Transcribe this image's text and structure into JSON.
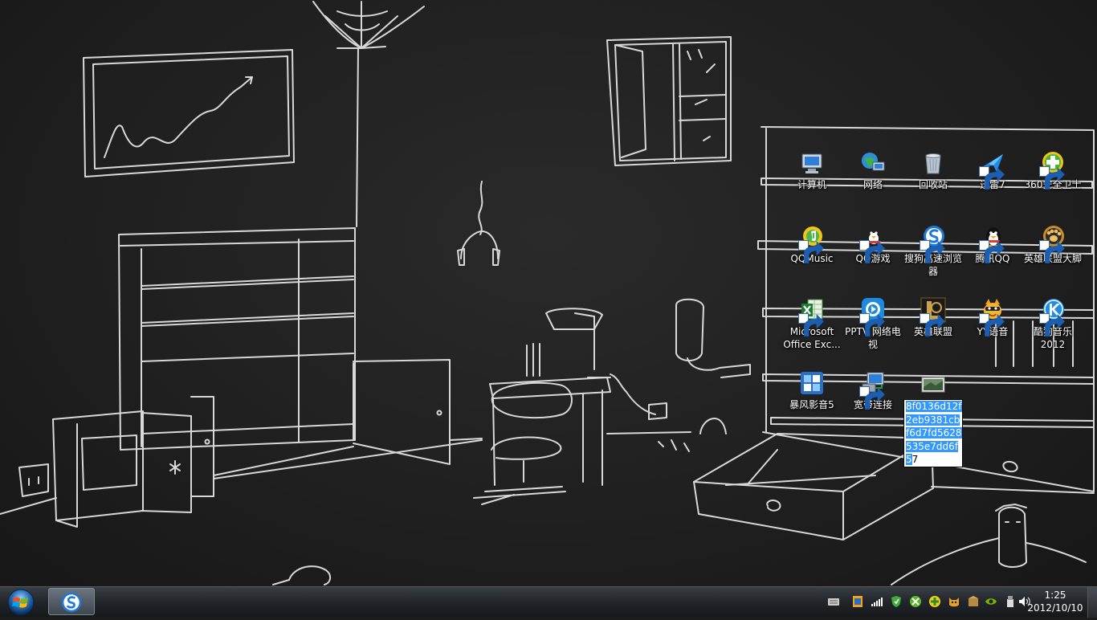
{
  "desktop": {
    "icons": [
      {
        "label": "计算机",
        "icon": "computer-icon",
        "shortcut": false
      },
      {
        "label": "网络",
        "icon": "network-icon",
        "shortcut": false
      },
      {
        "label": "回收站",
        "icon": "recycle-bin-icon",
        "shortcut": false
      },
      {
        "label": "迅雷7",
        "icon": "xunlei-icon",
        "shortcut": true
      },
      {
        "label": "360安全卫士",
        "icon": "360-safe-icon",
        "shortcut": true
      },
      {
        "label": "QQMusic",
        "icon": "qqmusic-icon",
        "shortcut": true
      },
      {
        "label": "QQ游戏",
        "icon": "qqgame-icon",
        "shortcut": true
      },
      {
        "label": "搜狗高速浏览器",
        "icon": "sogou-browser-icon",
        "shortcut": true
      },
      {
        "label": "腾讯QQ",
        "icon": "qq-penguin-icon",
        "shortcut": true
      },
      {
        "label": "英雄联盟大脚",
        "icon": "lol-dajiao-icon",
        "shortcut": true
      },
      {
        "label": "Microsoft Office Exc...",
        "icon": "excel-icon",
        "shortcut": true
      },
      {
        "label": "PPTV 网络电视",
        "icon": "pptv-icon",
        "shortcut": true
      },
      {
        "label": "英雄联盟",
        "icon": "lol-icon",
        "shortcut": true
      },
      {
        "label": "YY语音",
        "icon": "yy-voice-icon",
        "shortcut": true
      },
      {
        "label": "酷狗音乐2012",
        "icon": "kugou-icon",
        "shortcut": true
      },
      {
        "label": "暴风影音5",
        "icon": "baofeng-icon",
        "shortcut": false
      },
      {
        "label": "宽带连接",
        "icon": "broadband-icon",
        "shortcut": true
      }
    ],
    "rename": {
      "icon": "image-file-icon",
      "selected_text": "8f0136d12f2eb9381cbf6d7fd5628535e7dd6f5",
      "unselected_text": "7"
    }
  },
  "taskbar": {
    "start": {
      "icon": "windows-start-icon"
    },
    "pinned": [
      {
        "icon": "sogou-browser-icon"
      }
    ],
    "tray_icons": [
      "keyboard-icon",
      "flag-icon",
      "signal-icon",
      "360-shield-icon",
      "xbox-icon",
      "green-plus-icon",
      "cat-icon",
      "box-icon",
      "nvidia-icon",
      "usb-icon",
      "volume-icon"
    ],
    "clock": {
      "time": "1:25",
      "date": "2012/10/10"
    }
  },
  "colors": {
    "chalk": "#e8e8e8",
    "selection": "#3399ff",
    "taskbar_top": "#3a3f45",
    "taskbar_bottom": "#15181b"
  }
}
